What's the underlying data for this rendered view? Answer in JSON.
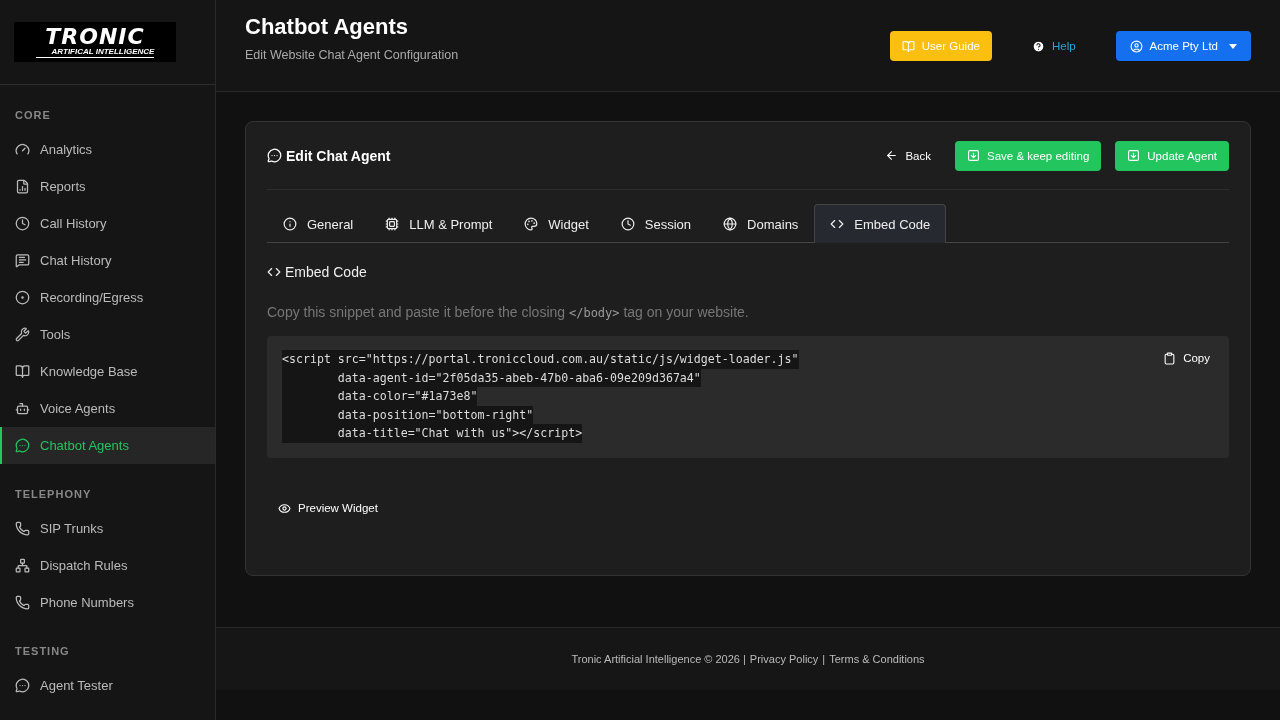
{
  "logo": {
    "title": "TRONIC",
    "subtitle": "ARTIFICAL INTELLIGENCE"
  },
  "sidebar": {
    "sections": [
      {
        "label": "CORE",
        "items": [
          {
            "label": "Analytics",
            "selected": false
          },
          {
            "label": "Reports",
            "selected": false
          },
          {
            "label": "Call History",
            "selected": false
          },
          {
            "label": "Chat History",
            "selected": false
          },
          {
            "label": "Recording/Egress",
            "selected": false
          },
          {
            "label": "Tools",
            "selected": false
          },
          {
            "label": "Knowledge Base",
            "selected": false
          },
          {
            "label": "Voice Agents",
            "selected": false
          },
          {
            "label": "Chatbot Agents",
            "selected": true
          }
        ]
      },
      {
        "label": "TELEPHONY",
        "items": [
          {
            "label": "SIP Trunks",
            "selected": false
          },
          {
            "label": "Dispatch Rules",
            "selected": false
          },
          {
            "label": "Phone Numbers",
            "selected": false
          }
        ]
      },
      {
        "label": "TESTING",
        "items": [
          {
            "label": "Agent Tester",
            "selected": false
          }
        ]
      }
    ]
  },
  "header": {
    "title": "Chatbot Agents",
    "subtitle": "Edit Website Chat Agent Configuration",
    "user_guide": "User Guide",
    "help": "Help",
    "account": "Acme Pty Ltd"
  },
  "card": {
    "title": "Edit Chat Agent",
    "back": "Back",
    "save": "Save & keep editing",
    "update": "Update Agent",
    "tabs": [
      {
        "label": "General",
        "selected": false
      },
      {
        "label": "LLM & Prompt",
        "selected": false
      },
      {
        "label": "Widget",
        "selected": false
      },
      {
        "label": "Session",
        "selected": false
      },
      {
        "label": "Domains",
        "selected": false
      },
      {
        "label": "Embed Code",
        "selected": true
      }
    ],
    "section_title": "Embed Code",
    "instruction": {
      "before": "Copy this snippet and paste it before the closing",
      "code": "</body>",
      "after": "tag on your website."
    },
    "code_lines": [
      "<script src=\"https://portal.troniccloud.com.au/static/js/widget-loader.js\"",
      "        data-agent-id=\"2f05da35-abeb-47b0-aba6-09e209d367a4\"",
      "        data-color=\"#1a73e8\"",
      "        data-position=\"bottom-right\"",
      "        data-title=\"Chat with us\"></script>"
    ],
    "copy": "Copy",
    "preview": "Preview Widget"
  },
  "footer": {
    "copyright": "Tronic Artificial Intelligence © 2026 |",
    "links": [
      "Privacy Policy",
      "Terms & Conditions"
    ],
    "separator": "|"
  }
}
